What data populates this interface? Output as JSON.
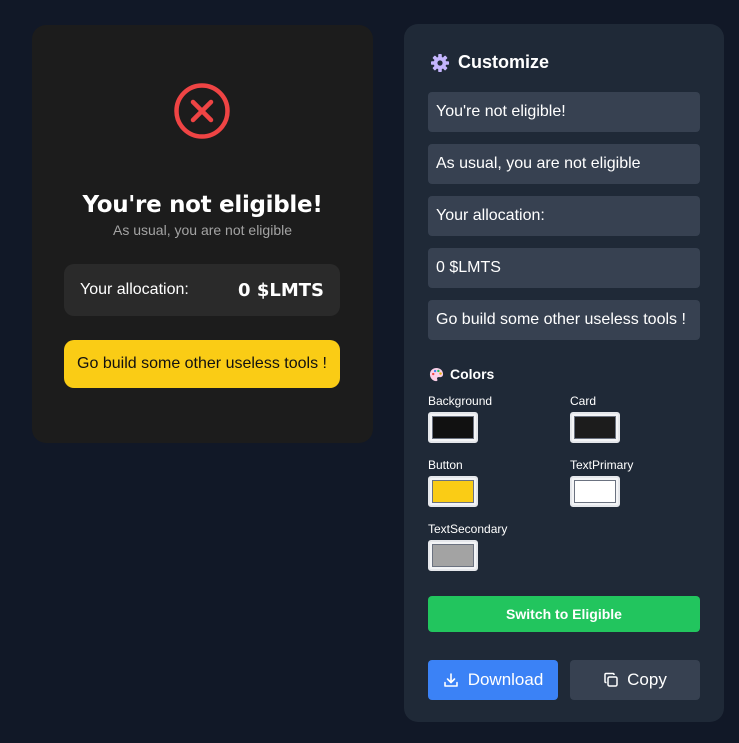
{
  "preview": {
    "icon": "x-circle-icon",
    "title": "You're not eligible!",
    "subtitle": "As usual, you are not eligible",
    "allocation_label": "Your allocation:",
    "allocation_value": "0 $LMTS",
    "button_label": "Go build some other useless tools !"
  },
  "customize": {
    "icon": "gear-icon",
    "title": "Customize",
    "fields": {
      "title": "You're not eligible!",
      "subtitle": "As usual, you are not eligible",
      "allocation_label": "Your allocation:",
      "allocation_value": "0 $LMTS",
      "button_label": "Go build some other useless tools !"
    },
    "colors_icon": "palette-icon",
    "colors_title": "Colors",
    "colors": {
      "background": {
        "label": "Background",
        "value": "#111111"
      },
      "card": {
        "label": "Card",
        "value": "#1c1c1c"
      },
      "button": {
        "label": "Button",
        "value": "#facc15"
      },
      "text_primary": {
        "label": "TextPrimary",
        "value": "#ffffff"
      },
      "text_secondary": {
        "label": "TextSecondary",
        "value": "#a3a3a3"
      }
    },
    "switch_label": "Switch to Eligible",
    "download_icon": "download-icon",
    "download_label": "Download",
    "copy_icon": "copy-icon",
    "copy_label": "Copy"
  },
  "theme": {
    "page_bg": "#111827",
    "panel_bg": "#1f2937",
    "input_bg": "#374151",
    "error_red": "#ef4444",
    "switch_green": "#22c55e",
    "download_blue": "#3b82f6"
  }
}
